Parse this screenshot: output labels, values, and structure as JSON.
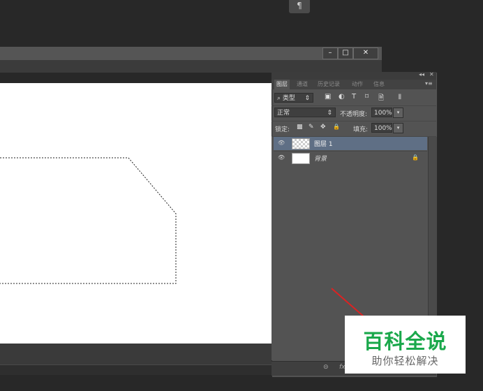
{
  "app": {
    "para_icon": "¶",
    "window_controls": {
      "minimize": "–",
      "maximize": "□",
      "close": "✕"
    }
  },
  "layers_panel": {
    "top_icons": {
      "collapse": "◂◂",
      "close": "✕"
    },
    "tabs": [
      "图层",
      "通道",
      "历史记录",
      "动作",
      "信息"
    ],
    "menu_icon": "▾≡",
    "filter": {
      "icon": "⌕",
      "label": "类型",
      "arrow": "⇕"
    },
    "filter_tools": [
      "▣",
      "◐",
      "T",
      "⌑",
      "🗎",
      "▮"
    ],
    "blend_mode": "正常",
    "opacity_label": "不透明度:",
    "opacity_value": "100%",
    "lock_label": "锁定:",
    "lock_icons": [
      "▩",
      "✎",
      "✥",
      "🔒"
    ],
    "fill_label": "填充:",
    "fill_value": "100%",
    "layers": [
      {
        "name": "图层 1",
        "selected": true,
        "visible_icon": "👁"
      },
      {
        "name": "背景",
        "selected": false,
        "visible_icon": "👁",
        "lock_icon": "🔒"
      }
    ],
    "footer_icons": [
      "⊝",
      "fx"
    ]
  },
  "watermark": {
    "title": "百科全说",
    "subtitle": "助你轻松解决"
  }
}
